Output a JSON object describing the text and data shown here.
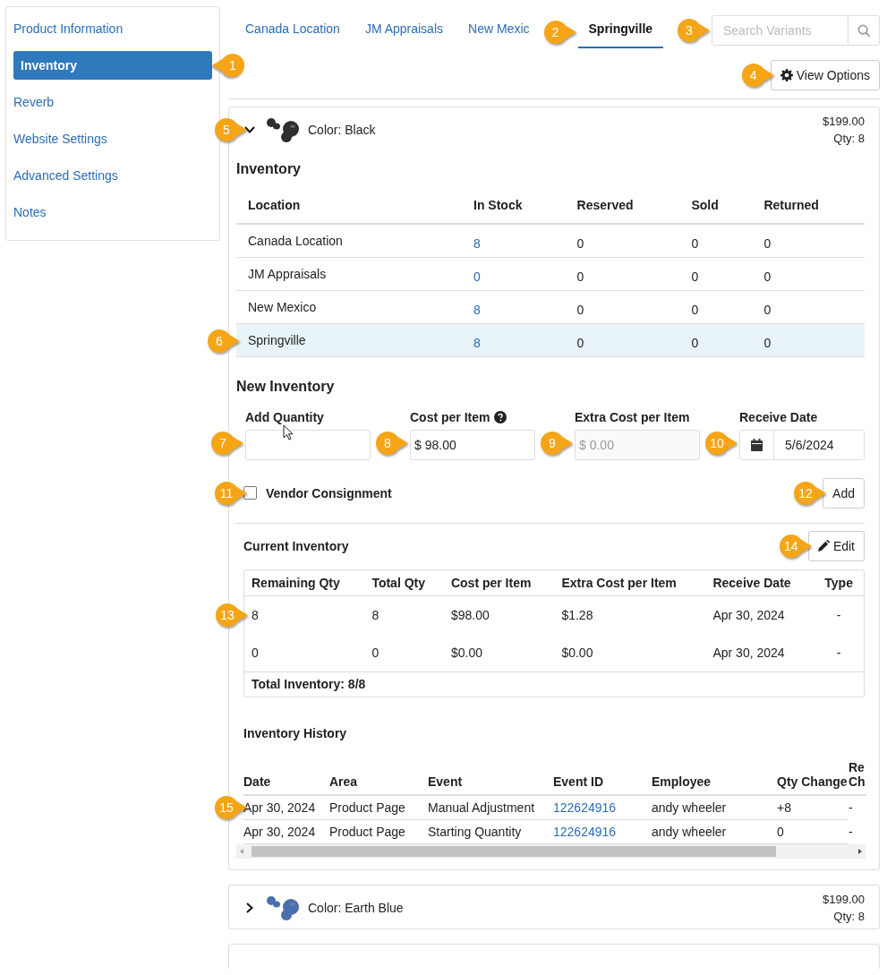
{
  "sidebar": {
    "items": [
      {
        "label": "Product Information",
        "selected": false
      },
      {
        "label": "Inventory",
        "selected": true,
        "callout": "1"
      },
      {
        "label": "Reverb",
        "selected": false
      },
      {
        "label": "Website Settings",
        "selected": false
      },
      {
        "label": "Advanced Settings",
        "selected": false
      },
      {
        "label": "Notes",
        "selected": false
      }
    ]
  },
  "location_tabs": [
    {
      "label": "Canada Location",
      "selected": false
    },
    {
      "label": "JM Appraisals",
      "selected": false
    },
    {
      "label": "New Mexic",
      "selected": false
    },
    {
      "label": "Springville",
      "selected": true,
      "callout": "2"
    }
  ],
  "search": {
    "placeholder": "Search Variants",
    "callout": "3"
  },
  "view_options": {
    "label": "View Options",
    "callout": "4"
  },
  "variants": [
    {
      "label": "Color: Black",
      "color": "#2e2e2e",
      "price": "$199.00",
      "qty": "Qty: 8",
      "expanded": true,
      "callout": "5",
      "detail": {
        "inventory": {
          "title": "Inventory",
          "columns": [
            {
              "label": "Location",
              "kind": "text"
            },
            {
              "label": "In Stock",
              "kind": "link"
            },
            {
              "label": "Reserved",
              "kind": "text"
            },
            {
              "label": "Sold",
              "kind": "text"
            },
            {
              "label": "Returned",
              "kind": "text"
            }
          ],
          "rows": [
            {
              "cells": [
                "Canada Location",
                "8",
                "0",
                "0",
                "0"
              ],
              "selected": false
            },
            {
              "cells": [
                "JM Appraisals",
                "0",
                "0",
                "0",
                "0"
              ],
              "selected": false
            },
            {
              "cells": [
                "New Mexico",
                "8",
                "0",
                "0",
                "0"
              ],
              "selected": false
            },
            {
              "cells": [
                "Springville",
                "8",
                "0",
                "0",
                "0"
              ],
              "selected": true,
              "callout": "6"
            }
          ]
        },
        "new_inventory": {
          "title": "New Inventory",
          "fields": [
            {
              "label": "Add Quantity",
              "kind": "text",
              "callout": "7"
            },
            {
              "label": "Cost per Item",
              "kind": "text",
              "help": true,
              "value": "$ 98.00",
              "callout": "8"
            },
            {
              "label": "Extra Cost per Item",
              "kind": "text",
              "placeholder": "$ 0.00",
              "callout": "9"
            },
            {
              "label": "Receive Date",
              "kind": "date",
              "value": "5/6/2024",
              "callout": "10"
            }
          ],
          "consignment": {
            "label": "Vendor Consignment",
            "checked": false,
            "callout": "11"
          },
          "add_button": {
            "label": "Add",
            "callout": "12"
          }
        },
        "current_inventory": {
          "title": "Current Inventory",
          "edit_button": {
            "label": "Edit",
            "callout": "14"
          },
          "columns": [
            "Remaining Qty",
            "Total Qty",
            "Cost per Item",
            "Extra Cost per Item",
            "Receive Date",
            "Type"
          ],
          "rows": [
            {
              "cells": [
                "8",
                "8",
                "$98.00",
                "$1.28",
                "Apr 30, 2024",
                "-"
              ],
              "callout": "13"
            },
            {
              "cells": [
                "0",
                "0",
                "$0.00",
                "$0.00",
                "Apr 30, 2024",
                "-"
              ]
            }
          ],
          "total": "Total Inventory: 8/8"
        },
        "history": {
          "title": "Inventory History",
          "columns": [
            {
              "label": "Date",
              "kind": "text"
            },
            {
              "label": "Area",
              "kind": "text"
            },
            {
              "label": "Event",
              "kind": "text"
            },
            {
              "label": "Event ID",
              "kind": "link"
            },
            {
              "label": "Employee",
              "kind": "text"
            },
            {
              "label": "Qty Change",
              "kind": "text"
            },
            {
              "label": "Re Ch",
              "kind": "text"
            }
          ],
          "rows": [
            {
              "cells": [
                "Apr 30, 2024",
                "Product Page",
                "Manual Adjustment",
                "122624916",
                "andy wheeler",
                "+8",
                "-"
              ],
              "callout": "15"
            },
            {
              "cells": [
                "Apr 30, 2024",
                "Product Page",
                "Starting Quantity",
                "122624916",
                "andy wheeler",
                "0",
                "-"
              ]
            }
          ]
        }
      }
    },
    {
      "label": "Color: Earth Blue",
      "color": "#4a6fae",
      "price": "$199.00",
      "qty": "Qty: 8",
      "expanded": false
    }
  ]
}
